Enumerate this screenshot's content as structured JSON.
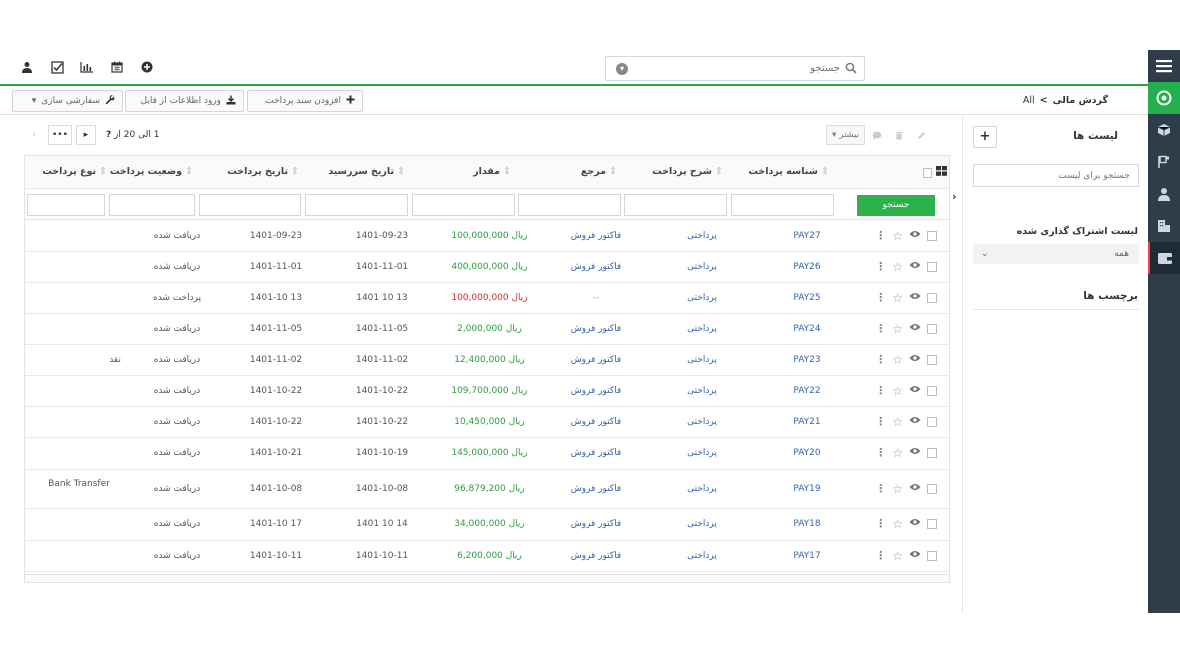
{
  "header": {
    "search_placeholder": "جستجو",
    "icons": [
      "user-icon",
      "checkbox-icon",
      "bar-chart-icon",
      "calendar-icon",
      "plus-circle-icon"
    ]
  },
  "breadcrumb": {
    "module": "گردش مالی",
    "separator": ">",
    "current": "All"
  },
  "toolbar": {
    "add_payment": "افزودن سند پرداخت",
    "import": "ورود اطلاعات از فایل",
    "customize": "سفارشی سازی"
  },
  "pager": {
    "range_text": "1 الی 20 از",
    "total": "?"
  },
  "actions": {
    "more": "بیشتر"
  },
  "columns": {
    "id": "شناسه پرداخت",
    "desc": "شرح پرداخت",
    "ref": "مرجع",
    "amount": "مقدار",
    "due": "تاریخ سررسید",
    "date": "تاریخ پرداخت",
    "status": "وضعیت پرداخت",
    "type": "نوع پرداخت"
  },
  "filter": {
    "search_btn": "جستجو"
  },
  "rows": [
    {
      "id": "PAY27",
      "desc": "پرداختی",
      "ref": "فاکتور فروش",
      "amount": "100,000,000 ریال",
      "sign": "pos",
      "due": "1401-09-23",
      "date": "1401-09-23",
      "status": "دریافت شده",
      "type": ""
    },
    {
      "id": "PAY26",
      "desc": "پرداختی",
      "ref": "فاکتور فروش",
      "amount": "400,000,000 ریال",
      "sign": "pos",
      "due": "1401-11-01",
      "date": "1401-11-01",
      "status": "دریافت شده",
      "type": ""
    },
    {
      "id": "PAY25",
      "desc": "پرداختی",
      "ref": "--",
      "amount": "100,000,000 ریال",
      "sign": "neg",
      "due": "1401 10 13",
      "date": "1401-10 13",
      "status": "پرداخت شده",
      "type": ""
    },
    {
      "id": "PAY24",
      "desc": "پرداختی",
      "ref": "فاکتور فروش",
      "amount": "2,000,000 ریال",
      "sign": "pos",
      "due": "1401-11-05",
      "date": "1401-11-05",
      "status": "دریافت شده",
      "type": ""
    },
    {
      "id": "PAY23",
      "desc": "پرداختی",
      "ref": "فاکتور فروش",
      "amount": "12,400,000 ریال",
      "sign": "pos",
      "due": "1401-11-02",
      "date": "1401-11-02",
      "status": "دریافت شده",
      "type": "نقد"
    },
    {
      "id": "PAY22",
      "desc": "پرداختی",
      "ref": "فاکتور فروش",
      "amount": "109,700,000 ریال",
      "sign": "pos",
      "due": "1401-10-22",
      "date": "1401-10-22",
      "status": "دریافت شده",
      "type": ""
    },
    {
      "id": "PAY21",
      "desc": "پرداختی",
      "ref": "فاکتور فروش",
      "amount": "10,450,000 ریال",
      "sign": "pos",
      "due": "1401-10-22",
      "date": "1401-10-22",
      "status": "دریافت شده",
      "type": ""
    },
    {
      "id": "PAY20",
      "desc": "پرداختی",
      "ref": "فاکتور فروش",
      "amount": "145,000,000 ریال",
      "sign": "pos",
      "due": "1401-10-19",
      "date": "1401-10-21",
      "status": "دریافت شده",
      "type": ""
    },
    {
      "id": "PAY19",
      "desc": "پرداختی",
      "ref": "فاکتور فروش",
      "amount": "96,879,200 ریال",
      "sign": "pos",
      "due": "1401-10-08",
      "date": "1401-10-08",
      "status": "دریافت شده",
      "type": "Bank Transfer"
    },
    {
      "id": "PAY18",
      "desc": "پرداختی",
      "ref": "فاکتور فروش",
      "amount": "34,000,000 ریال",
      "sign": "pos",
      "due": "1401 10 14",
      "date": "1401-10 17",
      "status": "دریافت شده",
      "type": ""
    },
    {
      "id": "PAY17",
      "desc": "پرداختی",
      "ref": "فاکتور فروش",
      "amount": "6,200,000 ریال",
      "sign": "pos",
      "due": "1401-10-11",
      "date": "1401-10-11",
      "status": "دریافت شده",
      "type": ""
    }
  ],
  "right_panel": {
    "lists_title": "لیست ها",
    "list_search_placeholder": "جستجو برای لیست",
    "shared_title": "لیست اشتراک گذاری شده",
    "shared_value": "همه",
    "tags_title": "برچسب ها"
  },
  "colors": {
    "accent": "#28a745",
    "rail": "#2f3d4a",
    "link": "#3366aa",
    "positive": "#2b9e3b",
    "negative": "#d52b2b"
  }
}
